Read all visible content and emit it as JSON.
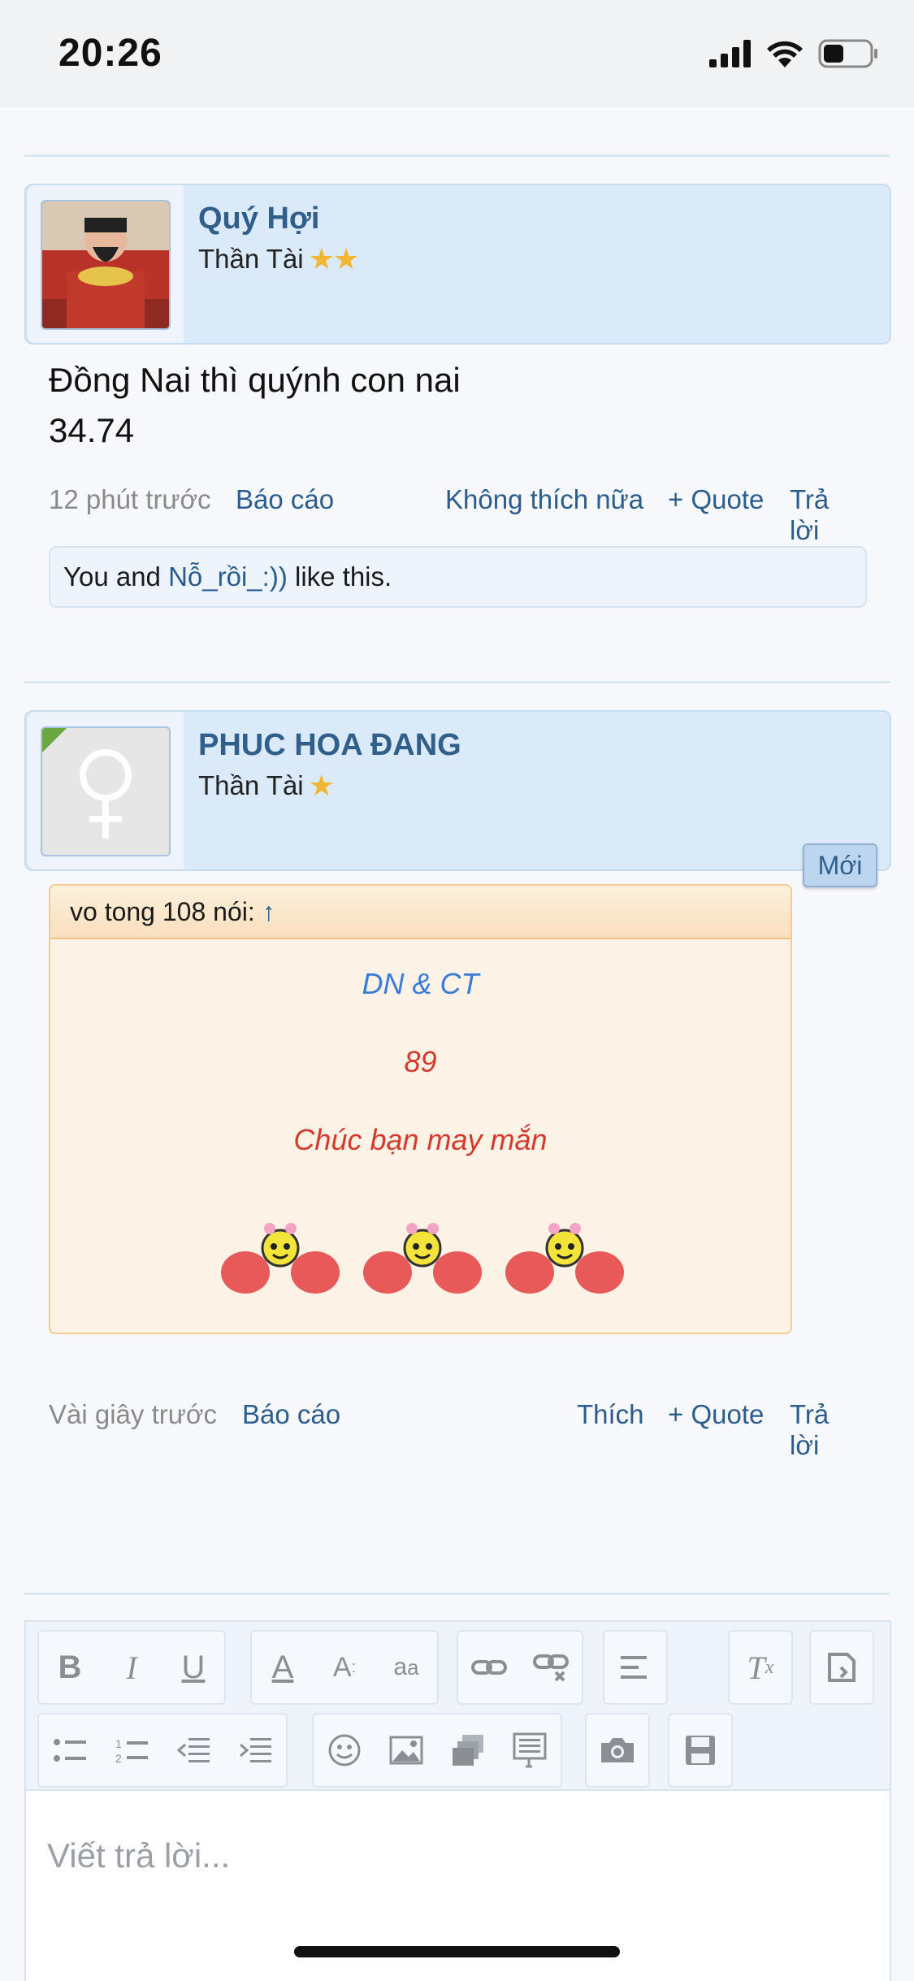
{
  "status_bar": {
    "time": "20:26",
    "battery_level": 0.45
  },
  "posts": [
    {
      "username": "Quý Hợi",
      "user_title": "Thần Tài",
      "stars": 2,
      "message_lines": [
        "Đồng Nai thì quýnh con nai",
        "34.74"
      ],
      "time": "12 phút trước",
      "report": "Báo cáo",
      "like_action": "Không thích nữa",
      "quote": "+ Quote",
      "reply": "Trả lời",
      "likes": {
        "prefix": "You and ",
        "user": "Nỗ_rồi_:))",
        "suffix": " like this."
      }
    },
    {
      "username": "PHUC HOA ĐANG",
      "user_title": "Thần Tài",
      "stars": 1,
      "badge": "Mới",
      "quote_block": {
        "header": "vo tong 108 nói:",
        "arrow": "↑",
        "lines": [
          "DN & CT",
          "89",
          "Chúc bạn may mắn"
        ],
        "line_colors": [
          "#3b7bd8",
          "#d63a2e",
          "#d63a2e"
        ]
      },
      "time": "Vài giây trước",
      "report": "Báo cáo",
      "like_action": "Thích",
      "quote": "+ Quote",
      "reply": "Trả lời"
    }
  ],
  "editor": {
    "placeholder": "Viết trả lời...",
    "toolbar_icons": [
      "bold-icon",
      "italic-icon",
      "underline-icon",
      "text-color-icon",
      "font-size-icon",
      "font-family-icon",
      "link-icon",
      "unlink-icon",
      "align-icon",
      "remove-format-icon",
      "code-icon",
      "bullet-list-icon",
      "numbered-list-icon",
      "outdent-icon",
      "indent-icon",
      "smiley-icon",
      "image-icon",
      "media-icon",
      "template-icon",
      "camera-icon",
      "save-icon"
    ]
  }
}
